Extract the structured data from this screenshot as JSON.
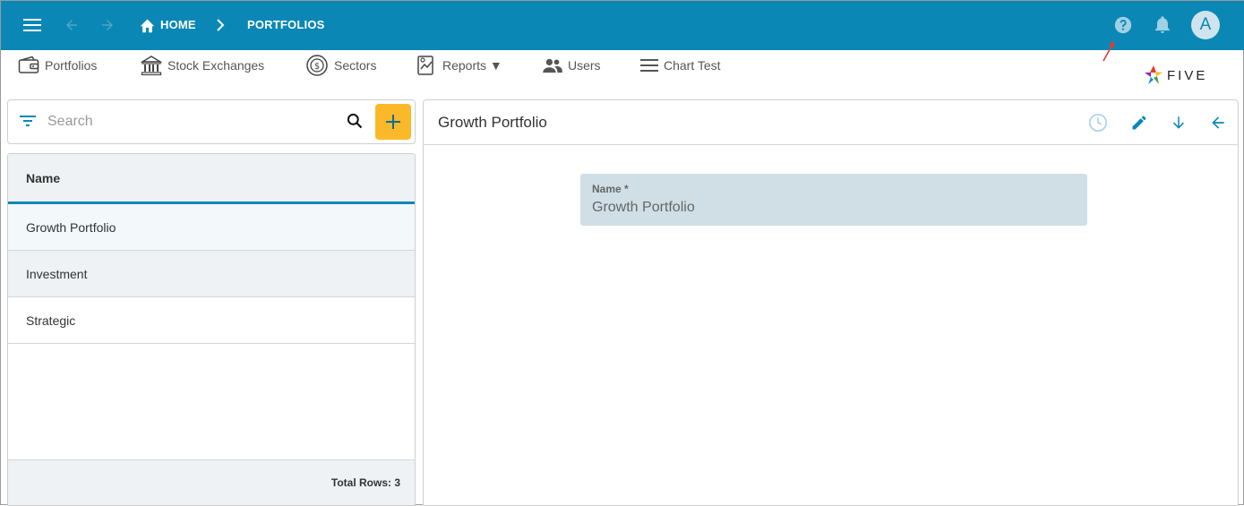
{
  "colors": {
    "appbar": "#0a87b5",
    "accent_button": "#fbb829",
    "field_bg": "#cfdfe5",
    "annotation_arrow": "#e53935"
  },
  "appbar": {
    "menu_icon": "hamburger-menu-icon",
    "back_icon": "arrow-left-icon",
    "forward_icon": "arrow-right-icon",
    "breadcrumb": {
      "home": "HOME",
      "current": "PORTFOLIOS"
    },
    "help_icon": "help-circle-icon",
    "notifications_icon": "bell-icon",
    "avatar_initial": "A"
  },
  "nav": {
    "items": [
      {
        "label": "Portfolios",
        "icon": "wallet-icon"
      },
      {
        "label": "Stock Exchanges",
        "icon": "bank-building-icon"
      },
      {
        "label": "Sectors",
        "icon": "dollar-cycle-icon"
      },
      {
        "label": "Reports ▼",
        "icon": "report-chart-icon"
      },
      {
        "label": "Users",
        "icon": "users-icon"
      },
      {
        "label": "Chart Test",
        "icon": "lines-icon"
      }
    ]
  },
  "logo": {
    "text": "FIVE"
  },
  "search": {
    "placeholder": "Search"
  },
  "list": {
    "header": "Name",
    "rows": [
      "Growth Portfolio",
      "Investment",
      "Strategic"
    ],
    "footer": "Total Rows: 3"
  },
  "detail": {
    "title": "Growth Portfolio",
    "field": {
      "label": "Name *",
      "value": "Growth Portfolio"
    }
  }
}
